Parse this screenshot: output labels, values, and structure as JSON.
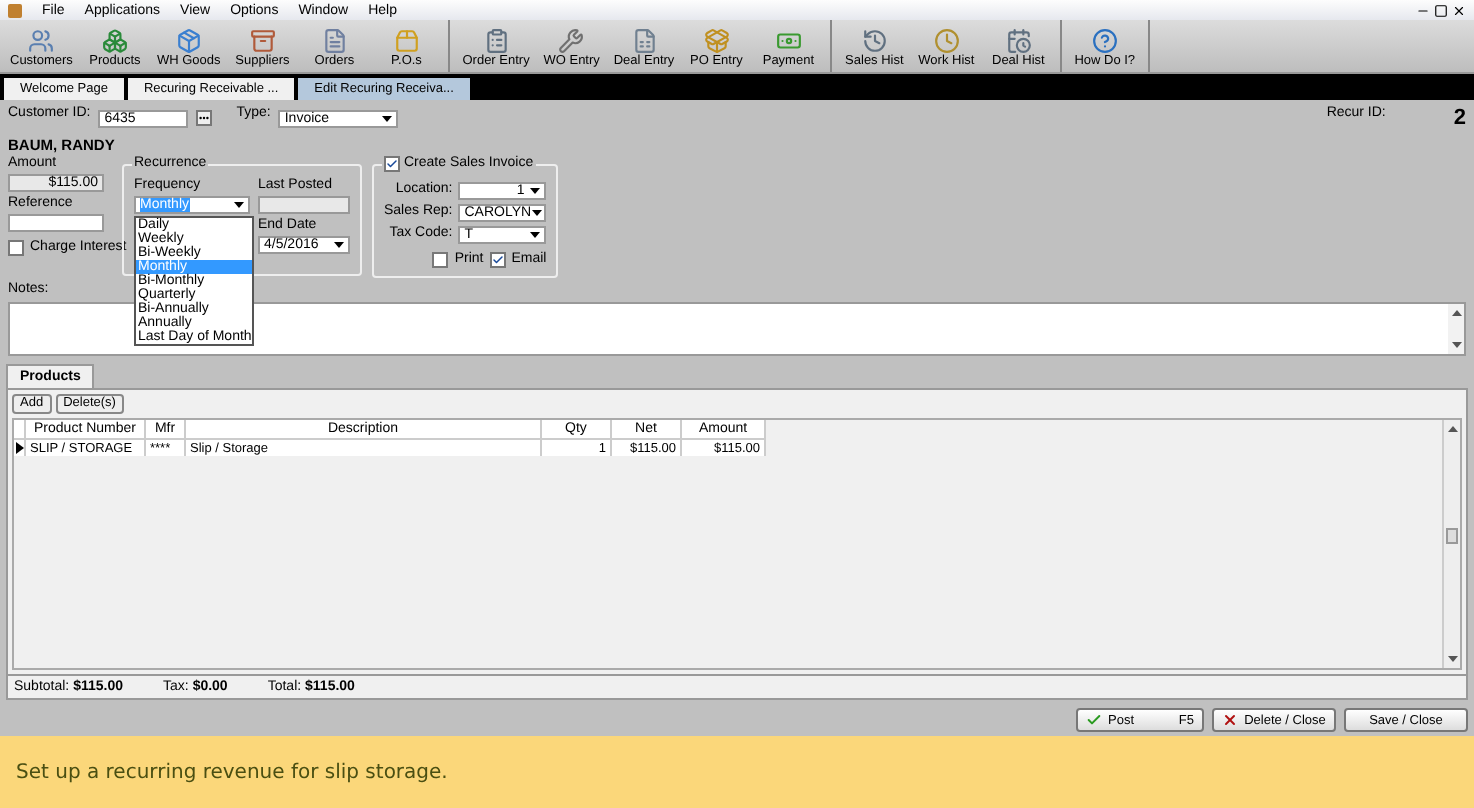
{
  "menu": [
    "File",
    "Applications",
    "View",
    "Options",
    "Window",
    "Help"
  ],
  "toolbar_groups": [
    [
      "Customers",
      "Products",
      "WH Goods",
      "Suppliers",
      "Orders",
      "P.O.s"
    ],
    [
      "Order Entry",
      "WO Entry",
      "Deal Entry",
      "PO Entry",
      "Payment"
    ],
    [
      "Sales Hist",
      "Work Hist",
      "Deal Hist"
    ],
    [
      "How Do I?"
    ]
  ],
  "tabs": [
    {
      "label": "Welcome Page",
      "selected": false
    },
    {
      "label": "Recuring Receivable ...",
      "selected": false
    },
    {
      "label": "Edit Recuring Receiva...",
      "selected": true
    }
  ],
  "customer": {
    "label": "Customer ID:",
    "value": "6435",
    "type_label": "Type:",
    "type_value": "Invoice",
    "name": "BAUM, RANDY",
    "recur_label": "Recur ID:",
    "recur_id": "2"
  },
  "amount": {
    "label": "Amount",
    "value": "$115.00",
    "reference_label": "Reference",
    "charge_interest": {
      "label": "Charge Interest",
      "checked": false
    }
  },
  "recurrence": {
    "title": "Recurrence",
    "frequency_label": "Frequency",
    "frequency": "Monthly",
    "last_posted_label": "Last Posted",
    "end_date_label": "End Date",
    "end_date": "4/5/2016",
    "options": [
      {
        "label": "Daily",
        "selected": false
      },
      {
        "label": "Weekly",
        "selected": false
      },
      {
        "label": "Bi-Weekly",
        "selected": false
      },
      {
        "label": "Monthly",
        "selected": true
      },
      {
        "label": "Bi-Monthly",
        "selected": false
      },
      {
        "label": "Quarterly",
        "selected": false
      },
      {
        "label": "Bi-Annually",
        "selected": false
      },
      {
        "label": "Annually",
        "selected": false
      },
      {
        "label": "Last Day of Month",
        "selected": false
      }
    ]
  },
  "sales_invoice": {
    "title": "Create Sales Invoice",
    "checked": true,
    "location_label": "Location:",
    "location": "1",
    "rep_label": "Sales Rep:",
    "rep": "CAROLYN",
    "tax_label": "Tax Code:",
    "tax": "T",
    "print": {
      "label": "Print",
      "checked": false
    },
    "email": {
      "label": "Email",
      "checked": true
    }
  },
  "notes_label": "Notes:",
  "products_tab": "Products",
  "grid_buttons": [
    "Add",
    "Delete(s)"
  ],
  "columns": [
    "Product Number",
    "Mfr",
    "Description",
    "Qty",
    "Net",
    "Amount"
  ],
  "rows": [
    [
      "SLIP / STORAGE",
      "****",
      "Slip / Storage",
      "1",
      "$115.00",
      "$115.00"
    ]
  ],
  "totals": [
    {
      "label": "Subtotal:",
      "value": "$115.00"
    },
    {
      "label": "Tax:",
      "value": "$0.00"
    },
    {
      "label": "Total:",
      "value": "$115.00"
    }
  ],
  "actions": [
    {
      "kind": "post",
      "label": "Post",
      "key": "F5"
    },
    {
      "kind": "delete",
      "label": "Delete / Close"
    },
    {
      "kind": "save",
      "label": "Save / Close"
    }
  ],
  "caption": "Set up a recurring revenue for slip storage."
}
